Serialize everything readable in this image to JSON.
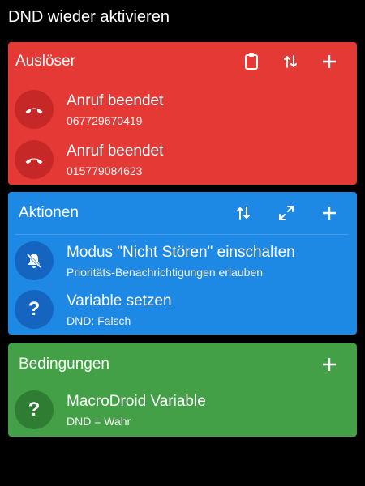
{
  "screen": {
    "title": "DND wieder aktivieren"
  },
  "colors": {
    "trigger": "#e53935",
    "trigger_circle": "#c62828",
    "action": "#1e88e5",
    "action_circle": "#1565c0",
    "condition": "#43a047",
    "condition_circle": "#2e7d32"
  },
  "triggers": {
    "title": "Auslöser",
    "icons": [
      "clipboard-icon",
      "reorder-icon",
      "add-icon"
    ],
    "items": [
      {
        "label": "Anruf beendet",
        "detail": "067729670419",
        "icon": "call-end-icon"
      },
      {
        "label": "Anruf beendet",
        "detail": "015779084623",
        "icon": "call-end-icon"
      }
    ]
  },
  "actions": {
    "title": "Aktionen",
    "icons": [
      "reorder-icon",
      "expand-icon",
      "add-icon"
    ],
    "items": [
      {
        "label": "Modus \"Nicht Stören\" einschalten",
        "detail": "Prioritäts-Benachrichtigungen erlauben",
        "icon": "notifications-off-icon"
      },
      {
        "label": "Variable setzen",
        "detail": "DND: Falsch",
        "icon": "question-mark-icon",
        "glyph": "?"
      }
    ]
  },
  "conditions": {
    "title": "Bedingungen",
    "icons": [
      "add-icon"
    ],
    "items": [
      {
        "label": "MacroDroid Variable",
        "detail": "DND = Wahr",
        "icon": "question-mark-icon",
        "glyph": "?"
      }
    ]
  }
}
